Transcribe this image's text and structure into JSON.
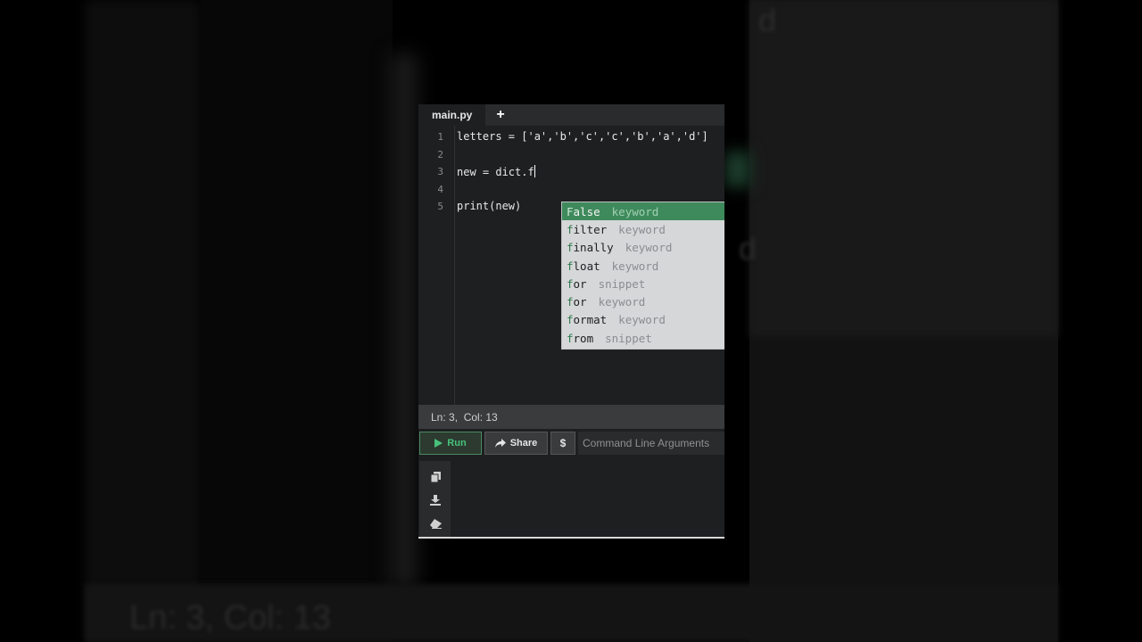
{
  "editor": {
    "tab_label": "main.py",
    "add_tab_glyph": "+",
    "line_numbers": [
      "1",
      "2",
      "3",
      "4",
      "5"
    ],
    "lines": {
      "l1": "letters = ['a','b','c','c','b','a','d']",
      "l3_prefix": "new = dict.",
      "l3_typed": "f",
      "l5": "print(new)"
    }
  },
  "autocomplete": {
    "items": [
      {
        "match": "F",
        "rest": "alse",
        "kind": "keyword"
      },
      {
        "match": "f",
        "rest": "ilter",
        "kind": "keyword"
      },
      {
        "match": "f",
        "rest": "inally",
        "kind": "keyword"
      },
      {
        "match": "f",
        "rest": "loat",
        "kind": "keyword"
      },
      {
        "match": "f",
        "rest": "or",
        "kind": "snippet"
      },
      {
        "match": "f",
        "rest": "or",
        "kind": "keyword"
      },
      {
        "match": "f",
        "rest": "ormat",
        "kind": "keyword"
      },
      {
        "match": "f",
        "rest": "rom",
        "kind": "snippet"
      }
    ],
    "selected_index": 0
  },
  "status": {
    "position": "Ln: 3,  Col: 13"
  },
  "toolbar": {
    "run_label": "Run",
    "share_label": "Share",
    "dollar_label": "$",
    "args_placeholder": "Command Line Arguments"
  },
  "console_tools": [
    "copy-icon",
    "download-icon",
    "eraser-icon"
  ],
  "background": {
    "big_status_text": "Ln: 3,  Col: 13"
  },
  "colors": {
    "accent_green": "#3f8a5c",
    "run_green": "#47c27a"
  }
}
